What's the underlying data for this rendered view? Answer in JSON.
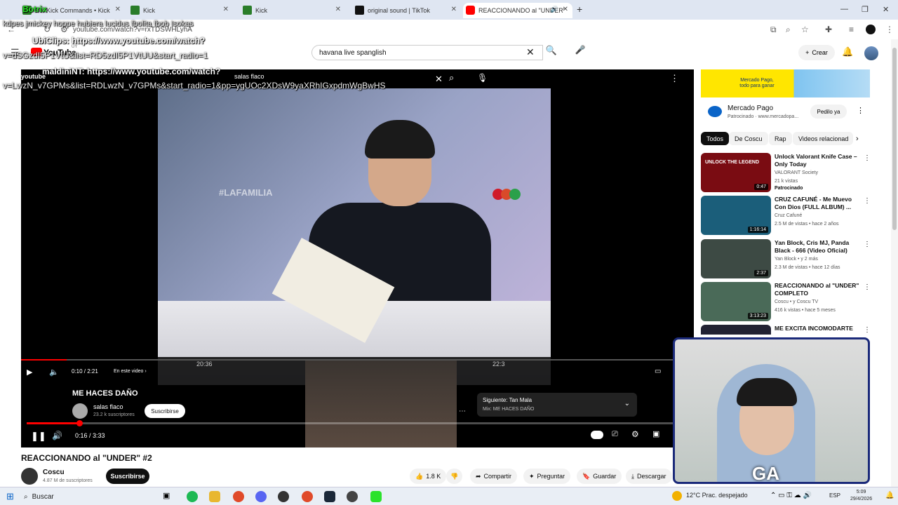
{
  "browser": {
    "tabs": [
      {
        "label": "Bot Kick Commands • Kick"
      },
      {
        "label": "Kick"
      },
      {
        "label": "Kick"
      },
      {
        "label": "original sound | TikTok"
      },
      {
        "label": "REACCIONANDO al \"UNDER\""
      }
    ],
    "url": "youtube.com/watch?v=rxTDSWHLyhA"
  },
  "youtube": {
    "logo": "YouTube",
    "country": "UY",
    "search_value": "havana live spanglish",
    "create_label": "Crear"
  },
  "chat_overlay": [
    {
      "text": "Botrix"
    },
    {
      "text": "kdpes jmickey hoppe hubiera lucidus fbolita fbob Isokas"
    },
    {
      "text": "UbiClips: https://www.youtube.com/watch?"
    },
    {
      "text": "v=dSGzdI5P1VtU&list=RD5zdI5P1VtUU&start_radio=1"
    },
    {
      "text": "maldiniNT: https://www.youtube.com/watch?"
    },
    {
      "text": "v=LwzN_v7GPMs&list=RDLwzN_v7GPMs&start_radio=1&pp=ygUOc2XDsW9yaXRhIGxpdmWgBwHS"
    },
    {
      "text": "youtube"
    },
    {
      "text": "salas flaco"
    }
  ],
  "player": {
    "inner_time": "0:10 / 2:21",
    "inner_chapter": "En este video",
    "inner_progress": 0.07,
    "inner_title": "ME HACES DAÑO",
    "inner_channel": "salas flaco",
    "inner_subs": "23.2 k suscriptores",
    "inner_subscribe": "Suscribirse",
    "next_label": "Siguiente: Tan Mala",
    "next_mix": "Mix: ME HACES DAÑO",
    "outer_time": "0:16 / 3:33",
    "outer_progress": 0.08,
    "scene_text": "#LAFAMILIA",
    "timestamp_left": "20:36",
    "timestamp_right": "22:3"
  },
  "video": {
    "title": "REACCIONANDO al \"UNDER\" #2",
    "channel": "Coscu",
    "subs": "4.87 M de suscriptores",
    "subscribe": "Suscribirse",
    "likes": "1.8 K",
    "share": "Compartir",
    "ask": "Preguntar",
    "save": "Guardar",
    "download": "Descargar"
  },
  "ad": {
    "banner_text": "Mercado Pago, todo para ganar",
    "name": "Mercado Pago",
    "sponsored": "Patrocinado · www.mercadopa...",
    "cta": "Pedilo ya"
  },
  "chips": [
    "Todos",
    "De Coscu",
    "Rap",
    "Videos relacionad"
  ],
  "recommendations": [
    {
      "title": "Unlock Valorant Knife Case – Only Today",
      "channel": "VALORANT Society",
      "stats": "21 k vistas",
      "extra": "Patrocinado",
      "duration": "0:47",
      "thumb_label": "UNLOCK THE LEGEND",
      "color": "#7a0c12"
    },
    {
      "title": "CRUZ CAFUNÉ - Me Muevo Con Dios (FULL ALBUM) ...",
      "channel": "Cruz Cafuné",
      "stats": "2.5 M de vistas • hace 2 años",
      "extra": "",
      "duration": "1:16:14",
      "thumb_label": "",
      "color": "#1b5e7a"
    },
    {
      "title": "Yan Block, Cris MJ, Panda Black - 666 (Video Oficial)",
      "channel": "Yan Block • y 2 más",
      "stats": "2.3 M de vistas • hace 12 días",
      "extra": "",
      "duration": "2:37",
      "thumb_label": "",
      "color": "#3d4a44"
    },
    {
      "title": "REACCIONANDO al \"UNDER\" COMPLETO",
      "channel": "Coscu • y Coscu TV",
      "stats": "416 k vistas • hace 5 meses",
      "extra": "",
      "duration": "3:13:23",
      "thumb_label": "",
      "color": "#4a6a58"
    },
    {
      "title": "ME EXCITA INCOMODARTE",
      "channel": "",
      "stats": "",
      "extra": "",
      "duration": "",
      "thumb_label": "",
      "color": "#223"
    }
  ],
  "webcam": {
    "tag": "GA"
  },
  "taskbar": {
    "search": "Buscar",
    "weather": "12°C  Prac. despejado",
    "lang": "ESP",
    "time": "5:09",
    "date": "29/4/2026"
  }
}
